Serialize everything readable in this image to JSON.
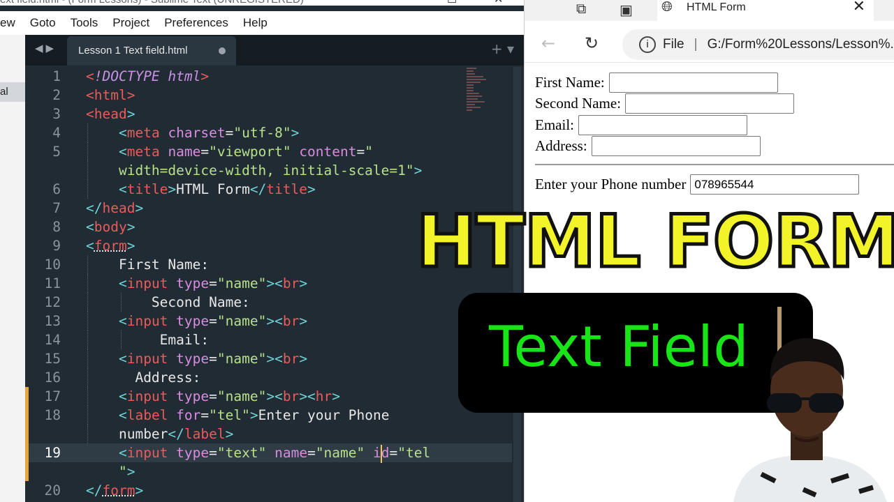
{
  "editor": {
    "title": "ext field.html - (Form Lessons) - Sublime Text (UNREGISTERED)",
    "menu": [
      "ew",
      "Goto",
      "Tools",
      "Project",
      "Preferences",
      "Help"
    ],
    "sidebar_item": "al",
    "tab_label": "Lesson 1 Text field.html",
    "code": {
      "l1_doctype": "!DOCTYPE",
      "l1_html": "html",
      "l2": "html",
      "l3": "head",
      "l4_tag": "meta",
      "l4_attr": "charset",
      "l4_val": "\"utf-8\"",
      "l5_tag": "meta",
      "l5_attr1": "name",
      "l5_val1": "\"viewport\"",
      "l5_attr2": "content",
      "l5_val2a": "\"",
      "l5_val2b": "width=device-width, initial-scale=1\"",
      "l6_tag": "title",
      "l6_text": "HTML Form",
      "l7": "head",
      "l8": "body",
      "l9": "form",
      "l10": "First Name:",
      "input": "input",
      "type": "type",
      "name_val": "\"name\"",
      "br": "br",
      "hr": "hr",
      "l12": "Second Name:",
      "l14": "Email:",
      "l16": "Address:",
      "l18_tag": "label",
      "l18_attr": "for",
      "l18_val": "\"tel\"",
      "l18_text": "Enter your Phone",
      "l18_text2": "number",
      "l19_type_val": "\"text\"",
      "l19_attr2": "name",
      "l19_attr3a": "i",
      "l19_attr3b": "d",
      "l19_val3": "\"tel",
      "l19_val3b": "\"",
      "l20": "form"
    },
    "line_numbers": [
      "1",
      "2",
      "3",
      "4",
      "5",
      "6",
      "7",
      "8",
      "9",
      "10",
      "11",
      "12",
      "13",
      "14",
      "15",
      "16",
      "17",
      "18",
      "19",
      "20"
    ]
  },
  "browser": {
    "tab_title": "HTML Form",
    "url_scheme": "File",
    "url": "G:/Form%20Lessons/Lesson%...",
    "form": {
      "first_name": "First Name:",
      "second_name": "Second Name:",
      "email": "Email:",
      "address": "Address:",
      "phone_label": "Enter your Phone number",
      "phone_value": "078965544"
    }
  },
  "overlay": {
    "title": "HTML FORM",
    "subtitle": "Text Field"
  },
  "colors": {
    "title_yellow": "#f3f32a",
    "subtitle_green": "#17e517",
    "editor_bg": "#202b33"
  }
}
